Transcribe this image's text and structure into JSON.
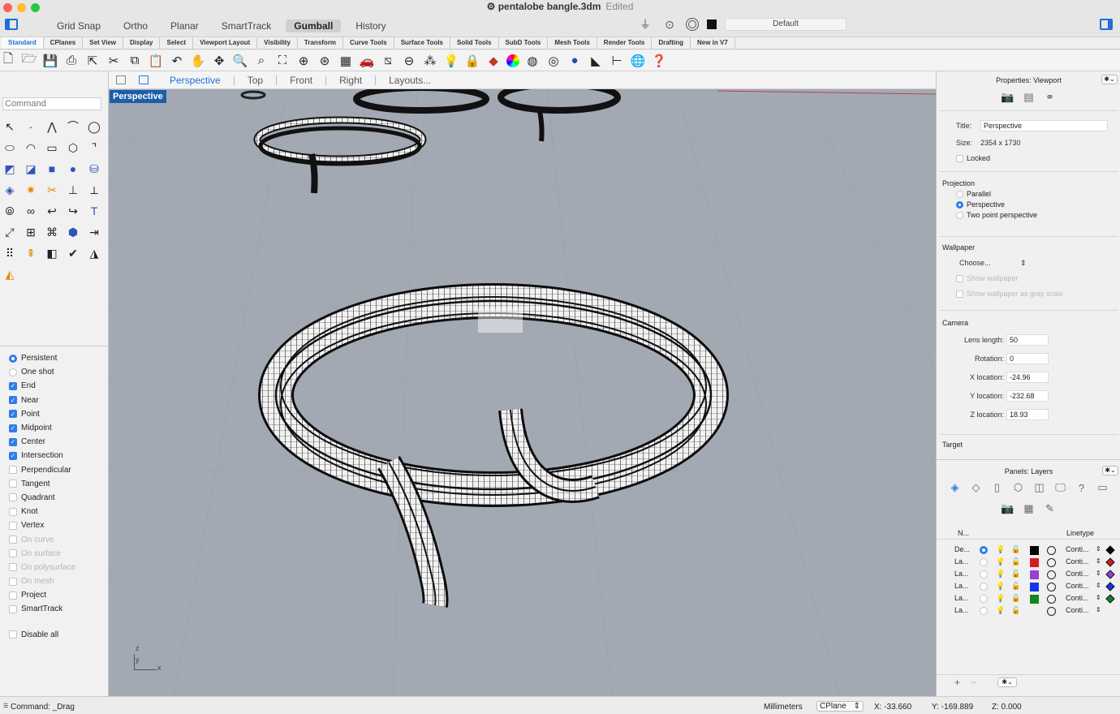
{
  "window": {
    "title": "pentalobe bangle.3dm",
    "status": "Edited"
  },
  "modes": [
    "Grid Snap",
    "Ortho",
    "Planar",
    "SmartTrack",
    "Gumball",
    "History"
  ],
  "active_mode": "Gumball",
  "display_mode": "Default",
  "toolbar_tabs": [
    "Standard",
    "CPlanes",
    "Set View",
    "Display",
    "Select",
    "Viewport Layout",
    "Visibility",
    "Transform",
    "Curve Tools",
    "Surface Tools",
    "Solid Tools",
    "SubD Tools",
    "Mesh Tools",
    "Render Tools",
    "Drafting",
    "New in V7"
  ],
  "command": {
    "placeholder": "Command"
  },
  "viewport_tabs": [
    "Perspective",
    "Top",
    "Front",
    "Right",
    "Layouts..."
  ],
  "active_viewport": "Perspective",
  "osnap": {
    "modes": [
      {
        "label": "Persistent",
        "type": "radio",
        "checked": true
      },
      {
        "label": "One shot",
        "type": "radio",
        "checked": false
      },
      {
        "label": "End",
        "type": "check",
        "checked": true
      },
      {
        "label": "Near",
        "type": "check",
        "checked": true
      },
      {
        "label": "Point",
        "type": "check",
        "checked": true
      },
      {
        "label": "Midpoint",
        "type": "check",
        "checked": true
      },
      {
        "label": "Center",
        "type": "check",
        "checked": true
      },
      {
        "label": "Intersection",
        "type": "check",
        "checked": true
      },
      {
        "label": "Perpendicular",
        "type": "check",
        "checked": false
      },
      {
        "label": "Tangent",
        "type": "check",
        "checked": false
      },
      {
        "label": "Quadrant",
        "type": "check",
        "checked": false
      },
      {
        "label": "Knot",
        "type": "check",
        "checked": false
      },
      {
        "label": "Vertex",
        "type": "check",
        "checked": false
      },
      {
        "label": "On curve",
        "type": "check",
        "checked": false,
        "disabled": true
      },
      {
        "label": "On surface",
        "type": "check",
        "checked": false,
        "disabled": true
      },
      {
        "label": "On polysurface",
        "type": "check",
        "checked": false,
        "disabled": true
      },
      {
        "label": "On mesh",
        "type": "check",
        "checked": false,
        "disabled": true
      },
      {
        "label": "Project",
        "type": "check",
        "checked": false
      },
      {
        "label": "SmartTrack",
        "type": "check",
        "checked": false
      }
    ],
    "disable_all": "Disable all"
  },
  "properties": {
    "header": "Properties: Viewport",
    "title_label": "Title:",
    "title_value": "Perspective",
    "size_label": "Size:",
    "size_value": "2354 x 1730",
    "locked_label": "Locked",
    "projection_label": "Projection",
    "projection_options": [
      "Parallel",
      "Perspective",
      "Two point perspective"
    ],
    "projection_selected": "Perspective",
    "wallpaper_label": "Wallpaper",
    "wallpaper_choose": "Choose...",
    "show_wallpaper": "Show wallpaper",
    "show_wallpaper_gray": "Show wallpaper as gray scale",
    "camera_label": "Camera",
    "camera_fields": [
      {
        "label": "Lens length:",
        "value": "50"
      },
      {
        "label": "Rotation:",
        "value": "0"
      },
      {
        "label": "X location:",
        "value": "-24.96"
      },
      {
        "label": "Y location:",
        "value": "-232.68"
      },
      {
        "label": "Z location:",
        "value": "18.93"
      }
    ],
    "target_label": "Target"
  },
  "layers": {
    "header": "Panels: Layers",
    "col_name": "N...",
    "col_linetype": "Linetype",
    "rows": [
      {
        "name": "De...",
        "current": true,
        "color": "#000000",
        "linetype": "Conti...",
        "mat": "#000000"
      },
      {
        "name": "La...",
        "current": false,
        "color": "#d81b1b",
        "linetype": "Conti...",
        "mat": "#d81b1b"
      },
      {
        "name": "La...",
        "current": false,
        "color": "#9b3fd1",
        "linetype": "Conti...",
        "mat": "#9b3fd1"
      },
      {
        "name": "La...",
        "current": false,
        "color": "#1536e6",
        "linetype": "Conti...",
        "mat": "#1536e6"
      },
      {
        "name": "La...",
        "current": false,
        "color": "#11871f",
        "linetype": "Conti...",
        "mat": "#11871f"
      },
      {
        "name": "La...",
        "current": false,
        "color": "",
        "linetype": "Conti...",
        "mat": ""
      }
    ]
  },
  "statusbar": {
    "command": "Command: _Drag",
    "units": "Millimeters",
    "cplane": "CPlane",
    "x": "X: -33.660",
    "y": "Y: -169.889",
    "z": "Z: 0.000"
  },
  "axis": {
    "z": "z",
    "y": "y",
    "x": "x"
  }
}
